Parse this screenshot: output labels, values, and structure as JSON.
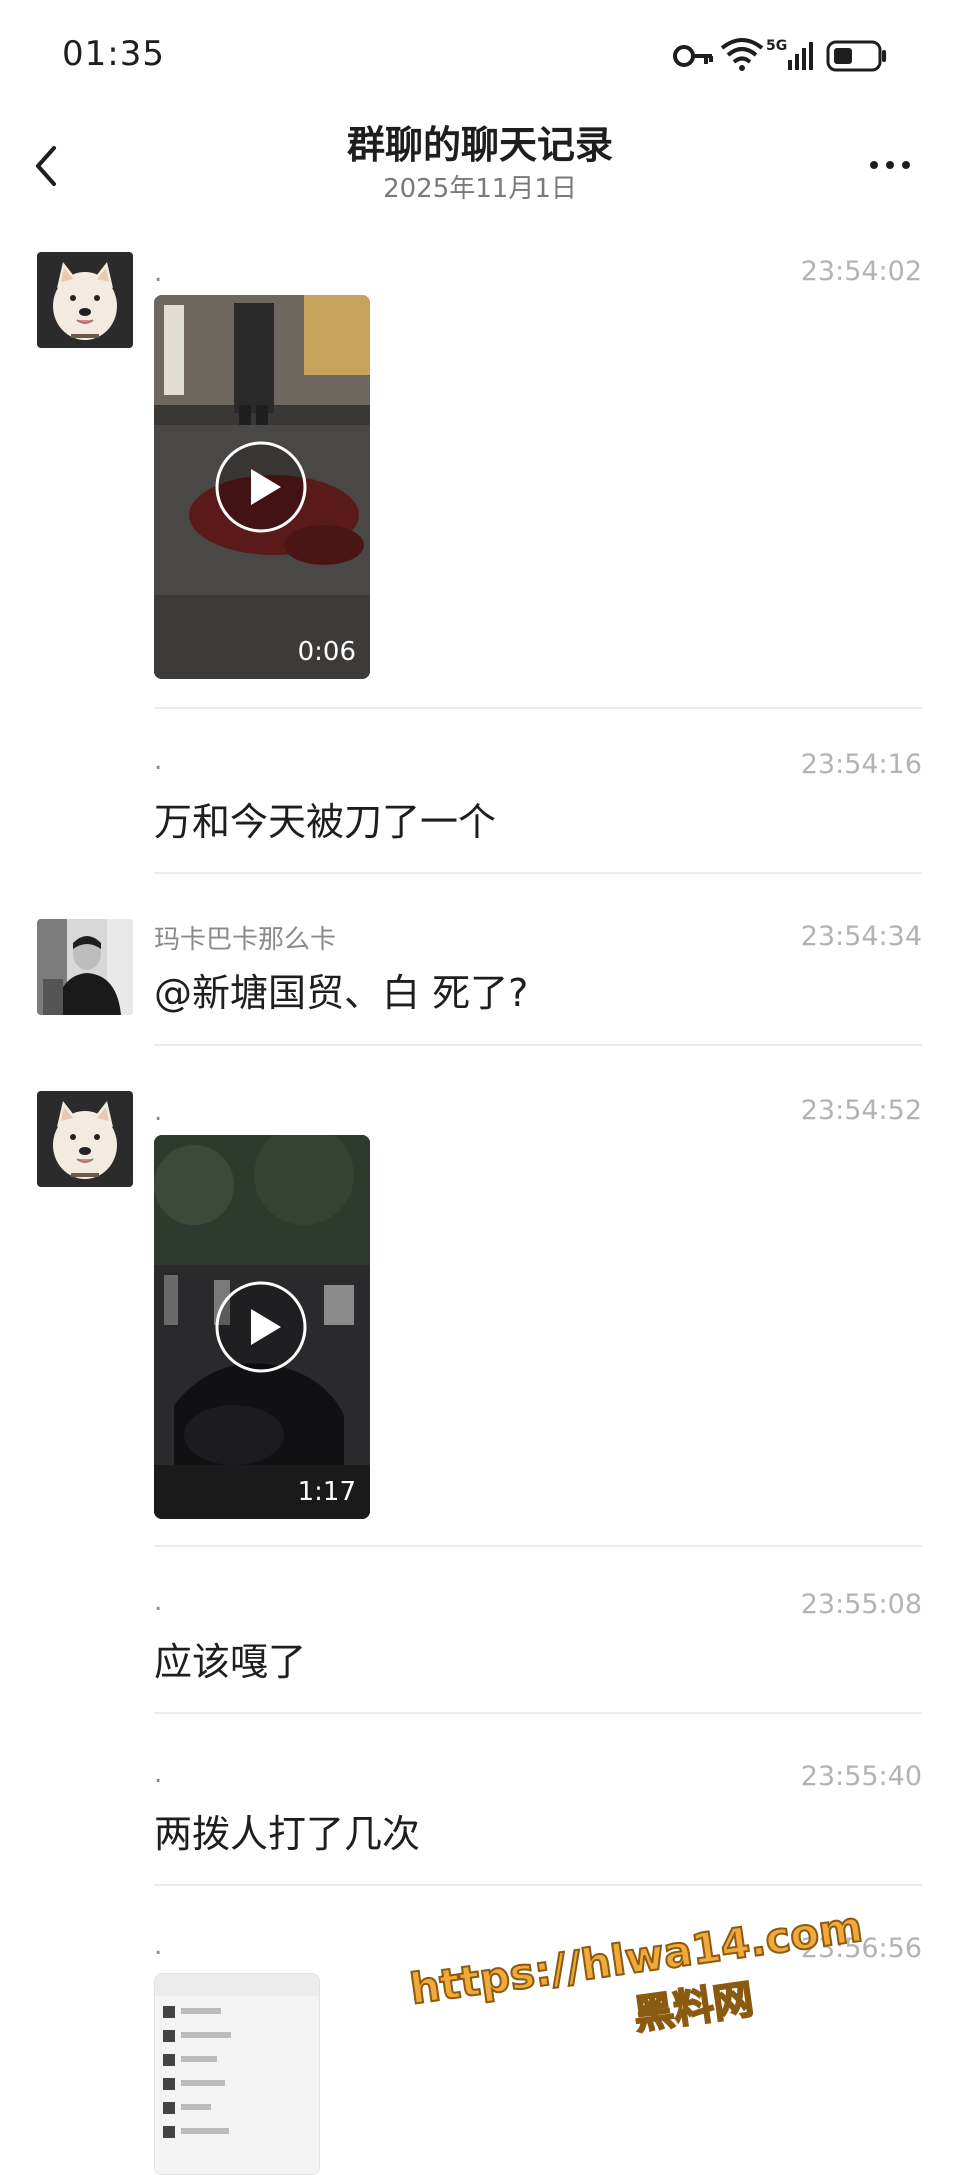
{
  "status": {
    "time": "01:35",
    "network": "5G"
  },
  "header": {
    "title": "群聊的聊天记录",
    "date": "2025年11月1日"
  },
  "messages": [
    {
      "sender": ".",
      "time": "23:54:02",
      "type": "video",
      "duration": "0:06",
      "avatar": "dog-avatar"
    },
    {
      "sender": ".",
      "time": "23:54:16",
      "type": "text",
      "text": "万和今天被刀了一个"
    },
    {
      "sender": "玛卡巴卡那么卡",
      "time": "23:54:34",
      "type": "text",
      "text": "@新塘国贸、白 死了?",
      "avatar": "man-avatar"
    },
    {
      "sender": ".",
      "time": "23:54:52",
      "type": "video",
      "duration": "1:17",
      "avatar": "dog-avatar"
    },
    {
      "sender": ".",
      "time": "23:55:08",
      "type": "text",
      "text": "应该嘎了"
    },
    {
      "sender": ".",
      "time": "23:55:40",
      "type": "text",
      "text": "两拨人打了几次"
    },
    {
      "sender": ".",
      "time": "23:56:56",
      "type": "image"
    }
  ],
  "watermark": {
    "url": "https://hlwa14.com",
    "name": "黑料网"
  }
}
